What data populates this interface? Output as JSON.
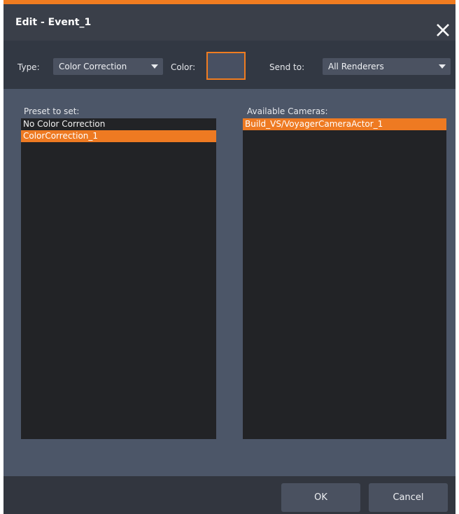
{
  "window": {
    "title": "Edit - Event_1",
    "accent_color": "#f07c20"
  },
  "toolbar": {
    "type_label": "Type:",
    "type_value": "Color Correction",
    "color_label": "Color:",
    "send_to_label": "Send to:",
    "send_to_value": "All Renderers"
  },
  "presets": {
    "label": "Preset to set:",
    "items": [
      {
        "label": "No Color Correction",
        "selected": false
      },
      {
        "label": "ColorCorrection_1",
        "selected": true
      }
    ]
  },
  "cameras": {
    "label": "Available Cameras:",
    "items": [
      {
        "label": "Build_VS/VoyagerCameraActor_1",
        "selected": true
      }
    ]
  },
  "footer": {
    "ok_label": "OK",
    "cancel_label": "Cancel"
  }
}
